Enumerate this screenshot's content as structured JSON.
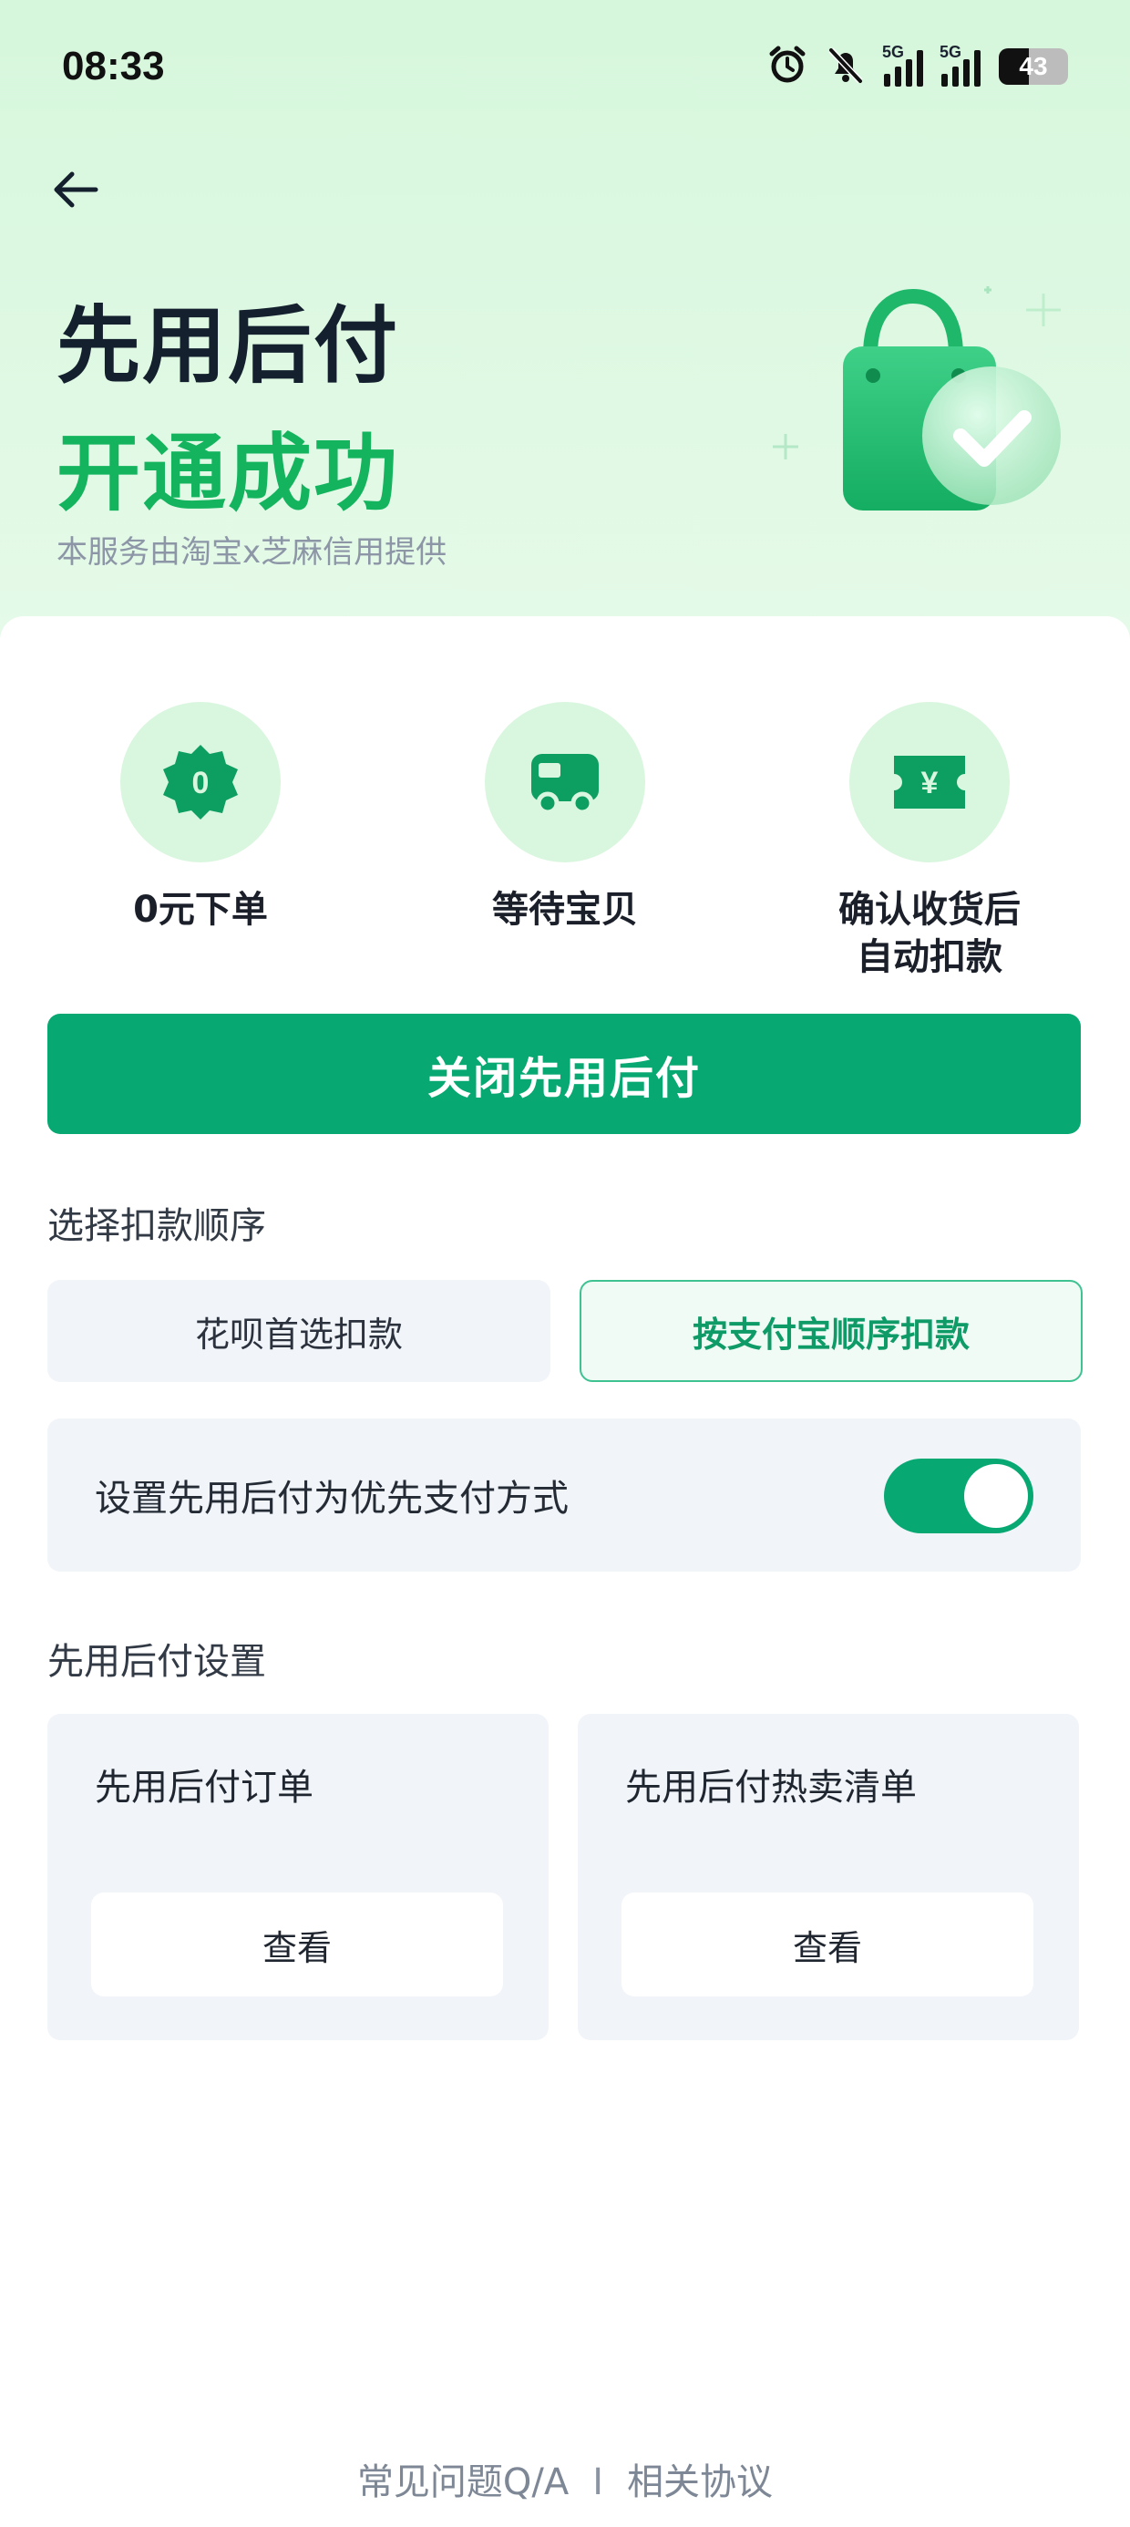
{
  "status_bar": {
    "time": "08:33",
    "network_1": "5G",
    "network_2": "5G",
    "battery": "43",
    "icons": [
      "alarm-icon",
      "mute-icon",
      "signal-icon",
      "signal-icon",
      "battery-icon"
    ]
  },
  "header": {
    "back_icon": "arrow-left-icon",
    "title": "先用后付",
    "subtitle": "开通成功",
    "provider_note": "本服务由淘宝x芝麻信用提供"
  },
  "steps": [
    {
      "icon": "zero-badge-icon",
      "icon_text": "0",
      "label": "0元下单"
    },
    {
      "icon": "truck-icon",
      "label": "等待宝贝"
    },
    {
      "icon": "yuan-ticket-icon",
      "icon_text": "¥",
      "label_line1": "确认收货后",
      "label_line2": "自动扣款"
    }
  ],
  "close_button": "关闭先用后付",
  "deduction": {
    "section_title": "选择扣款顺序",
    "options": [
      "花呗首选扣款",
      "按支付宝顺序扣款"
    ],
    "selected": "按支付宝顺序扣款"
  },
  "preference": {
    "label": "设置先用后付为优先支付方式",
    "enabled": true
  },
  "settings": {
    "section_title": "先用后付设置",
    "tiles": [
      {
        "title": "先用后付订单",
        "action": "查看"
      },
      {
        "title": "先用后付热卖清单",
        "action": "查看"
      }
    ]
  },
  "footer": {
    "faq": "常见问题Q/A",
    "separator": "I",
    "agreement": "相关协议"
  },
  "colors": {
    "accent": "#08a872",
    "success_text": "#14b45f",
    "hero_bg": "#d6f7dc",
    "panel_bg": "#f1f4f9"
  }
}
